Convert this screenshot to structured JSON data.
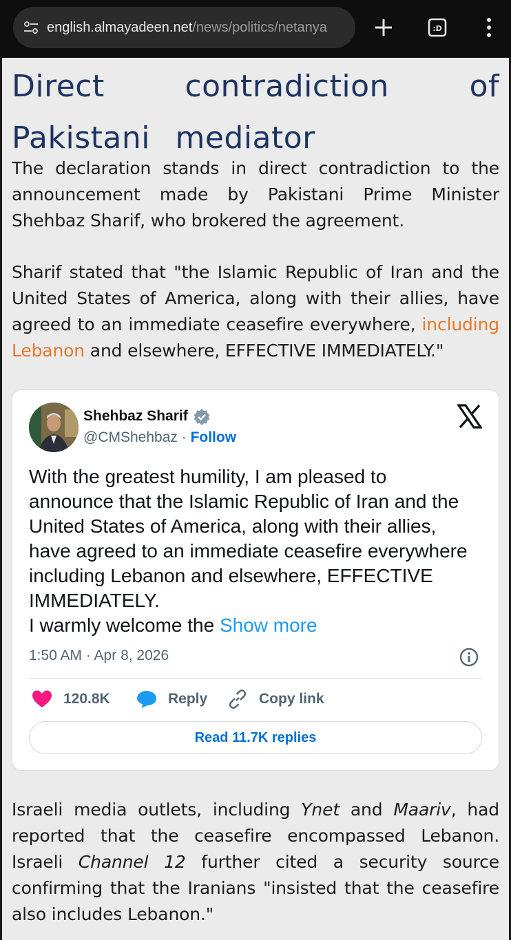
{
  "browser": {
    "url_domain": "english.almayadeen.net",
    "url_path": "/news/politics/netanya",
    "tabs_count": ":D"
  },
  "article": {
    "subheading": "Direct contradiction of Pakistani mediator",
    "para1": "The declaration stands in direct contradiction to the announcement made by Pakistani Prime Minister Shehbaz Sharif, who brokered the agreement.",
    "para2_before": "Sharif stated that \"the Islamic Republic of Iran and the United States of America, along with their allies, have agreed to an immediate ceasefire everywhere, ",
    "para2_link": "including Lebanon",
    "para2_after": " and elsewhere, EFFECTIVE IMMEDIATELY.\"",
    "para3": {
      "t1": "Israeli media outlets, including ",
      "i1": "Ynet",
      "t2": " and ",
      "i2": "Maariv",
      "t3": ", had reported that the ceasefire encompassed Lebanon. Israeli ",
      "i3": "Channel 12",
      "t4": " further cited a security source confirming that the Iranians \"insisted that the ceasefire also includes Lebanon.\""
    }
  },
  "tweet": {
    "author": "Shehbaz Sharif",
    "handle": "@CMShehbaz",
    "separator": " · ",
    "follow": "Follow",
    "text": "With the greatest humility, I am pleased to announce that the Islamic Republic of Iran and the United States of America, along with their allies, have agreed to an immediate ceasefire everywhere including Lebanon and elsewhere, EFFECTIVE IMMEDIATELY.\nI warmly welcome the ",
    "show_more": "Show more",
    "timestamp": "1:50 AM · Apr 8, 2026",
    "likes": "120.8K",
    "reply": "Reply",
    "copy_link": "Copy link",
    "read_replies": "Read 11.7K replies",
    "colors": {
      "like": "#f91880",
      "reply": "#1d9bf0",
      "link": "#006fd6"
    }
  },
  "colors": {
    "heading": "#1d3461",
    "accent_link": "#e8782c",
    "page_bg": "#ebebeb"
  }
}
